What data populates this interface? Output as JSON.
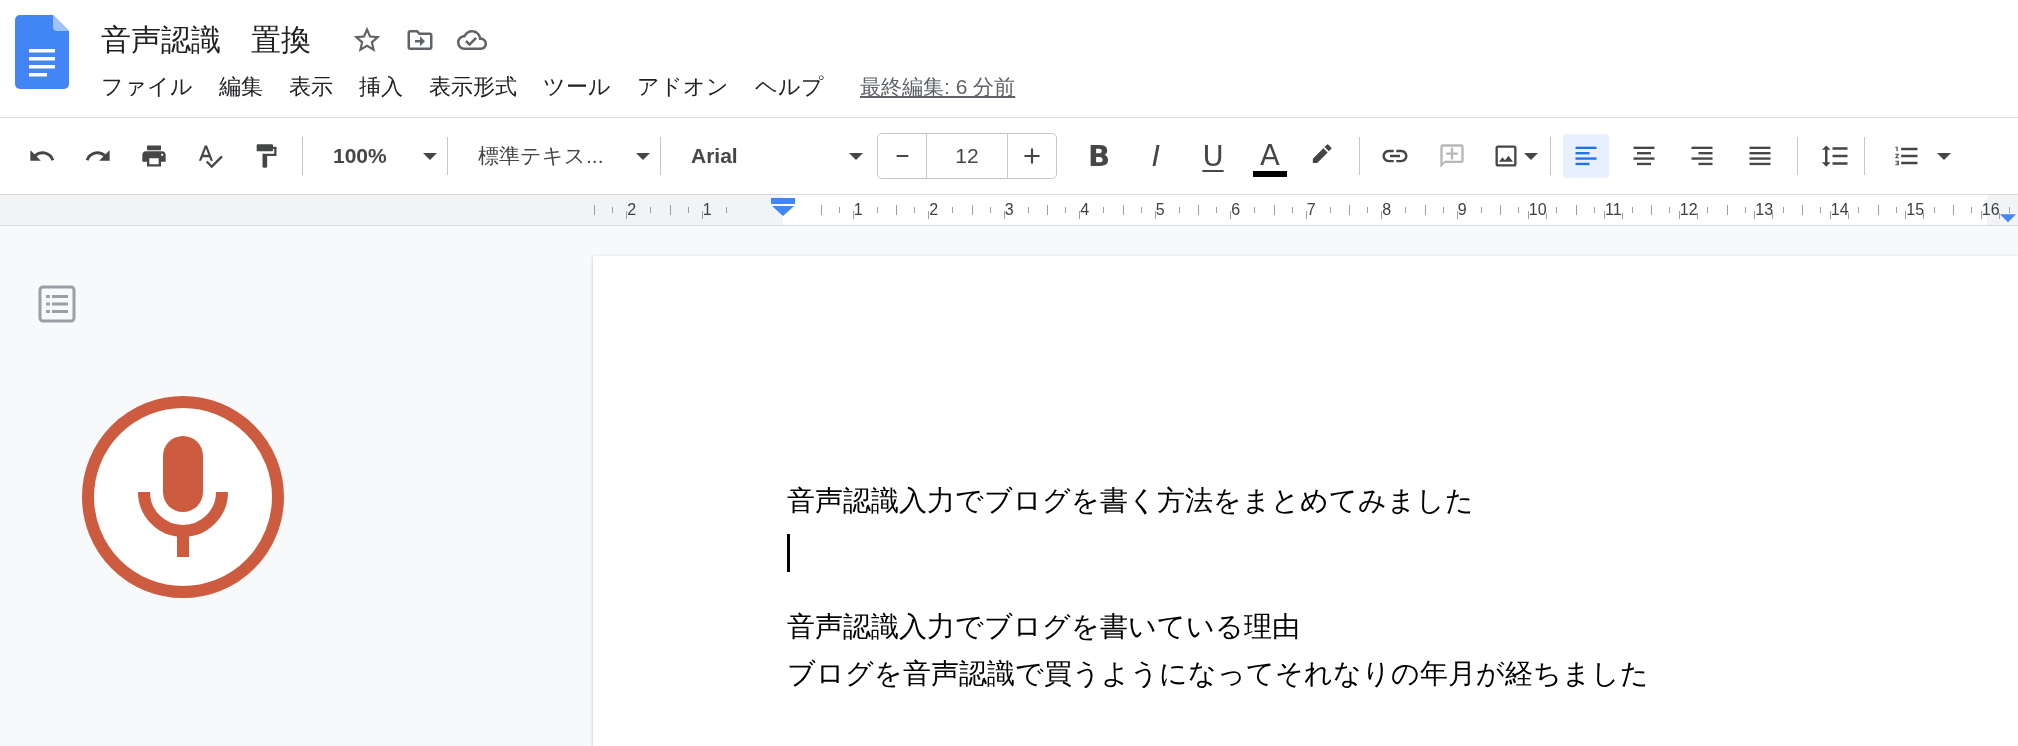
{
  "document_title": "音声認識　置換",
  "menu": [
    "ファイル",
    "編集",
    "表示",
    "挿入",
    "表示形式",
    "ツール",
    "アドオン",
    "ヘルプ"
  ],
  "last_edit": "最終編集: 6 分前",
  "toolbar": {
    "zoom": "100%",
    "style": "標準テキス...",
    "font": "Arial",
    "font_size": "12",
    "format": [
      {
        "kind": "bold",
        "glyph": "B"
      },
      {
        "kind": "italic",
        "glyph": "I"
      },
      {
        "kind": "underline",
        "glyph": "U"
      },
      {
        "kind": "text_color",
        "glyph": "A",
        "color": "#000000"
      }
    ],
    "alignment": [
      {
        "kind": "left",
        "selected": true
      },
      {
        "kind": "center",
        "selected": false
      },
      {
        "kind": "right",
        "selected": false
      },
      {
        "kind": "justify",
        "selected": false
      }
    ]
  },
  "ruler": {
    "left_numbers": [
      "2",
      "1"
    ],
    "right_numbers": [
      "1",
      "2",
      "3",
      "4",
      "5",
      "6",
      "7",
      "8",
      "9",
      "10",
      "11",
      "12",
      "13",
      "14",
      "15",
      "16"
    ]
  },
  "voice_typing": {
    "listening": true
  },
  "document": {
    "blocks": [
      {
        "kind": "text",
        "text": "音声認識入力でブログを書く方法をまとめてみました"
      },
      {
        "kind": "cursor"
      },
      {
        "kind": "text",
        "text": "音声認識入力でブログを書いている理由"
      },
      {
        "kind": "text",
        "text": "ブログを音声認識で買うようになってそれなりの年月が経ちました"
      }
    ]
  }
}
